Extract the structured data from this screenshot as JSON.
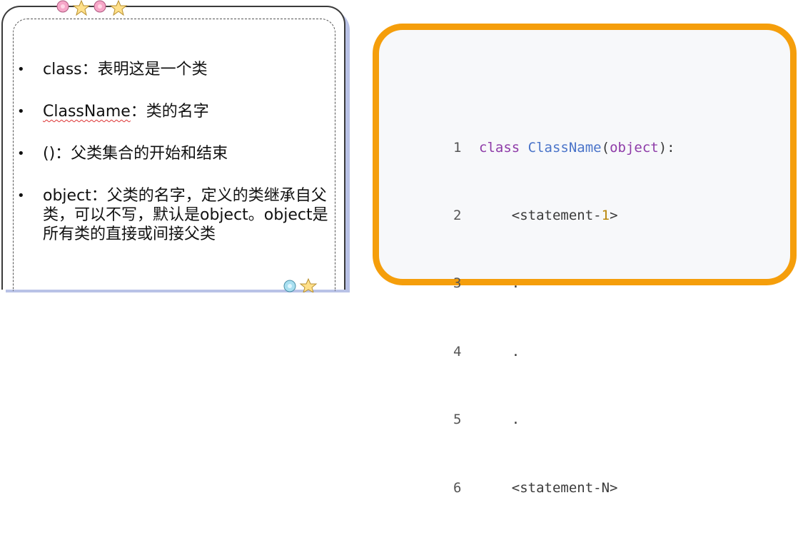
{
  "bullets": [
    {
      "head": "class",
      "text": "：表明这是一个类"
    },
    {
      "head": "ClassName",
      "text": "：类的名字"
    },
    {
      "head": "()",
      "text": "：父类集合的开始和结束"
    },
    {
      "head": "object",
      "text": "：父类的名字，定义的类继承自父类，可以不写，默认是object。object是所有类的直接或间接父类"
    }
  ],
  "code": {
    "lines": [
      {
        "num": "1",
        "kw": "class",
        "cls": "ClassName",
        "open": "(",
        "base": "object",
        "close": "):"
      },
      {
        "num": "2",
        "text_a": "<statement-",
        "digit": "1",
        "text_b": ">"
      },
      {
        "num": "3",
        "text": "."
      },
      {
        "num": "4",
        "text": "."
      },
      {
        "num": "5",
        "text": "."
      },
      {
        "num": "6",
        "text": "<statement-N>"
      }
    ]
  },
  "colors": {
    "frame_orange": "#f59e0b",
    "keyword_purple": "#8e3ba8",
    "class_blue": "#4a74c9",
    "number_gold": "#b8860b"
  },
  "icons": [
    "star-icon",
    "flower-icon"
  ]
}
